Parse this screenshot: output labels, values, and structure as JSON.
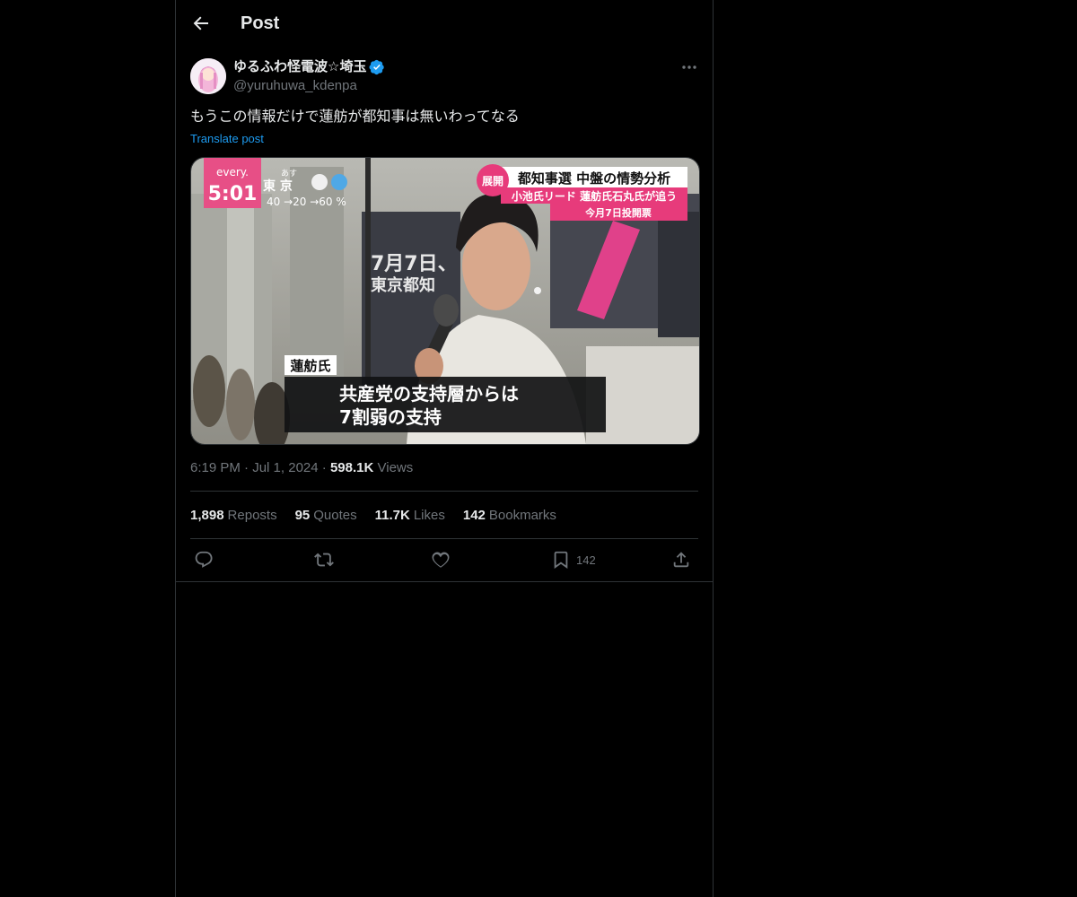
{
  "header": {
    "title": "Post"
  },
  "author": {
    "name": "ゆるふわ怪電波☆埼玉",
    "handle": "@yuruhuwa_kdenpa",
    "verified_color": "#1d9bf0"
  },
  "post": {
    "text": "もうこの情報だけで蓮舫が都知事は無いわってなる",
    "translate_label": "Translate post",
    "time": "6:19 PM",
    "date": "Jul 1, 2024",
    "views_count": "598.1K",
    "views_label": "Views"
  },
  "media": {
    "logo_text": "every.",
    "clock": "5:01",
    "weather_city": "東 京",
    "weather_small": "あす",
    "weather_temps": "40 →20 →60 %",
    "banner_tag": "展開",
    "banner_title": "都知事選 中盤の情勢分析",
    "banner_sub": "小池氏リード 蓮舫氏石丸氏が追う",
    "banner_date": "今月7日投開票",
    "sign_date": "7月7日、",
    "sign_place": "東京都知",
    "name_tag": "蓮舫氏",
    "caption_line1": "共産党の支持層からは",
    "caption_line2": "7割弱の支持"
  },
  "stats": {
    "reposts_count": "1,898",
    "reposts_label": "Reposts",
    "quotes_count": "95",
    "quotes_label": "Quotes",
    "likes_count": "11.7K",
    "likes_label": "Likes",
    "bookmarks_count": "142",
    "bookmarks_label": "Bookmarks"
  },
  "actions": {
    "bookmark_count": "142"
  },
  "icons": [
    "back-arrow-icon",
    "verified-badge-icon",
    "more-icon",
    "reply-icon",
    "repost-icon",
    "like-icon",
    "bookmark-icon",
    "share-icon"
  ]
}
